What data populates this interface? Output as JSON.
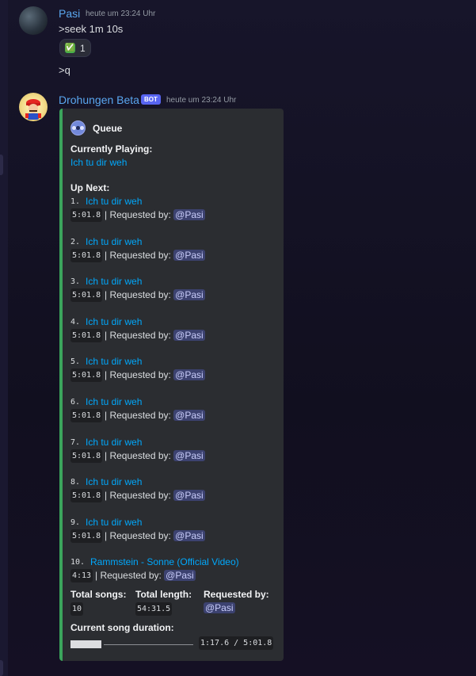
{
  "messages": [
    {
      "author": "Pasi",
      "timestamp": "heute um 23:24 Uhr",
      "lines": [
        ">seek 1m 10s",
        ">q"
      ],
      "reaction": {
        "emoji": "✅",
        "count": "1"
      }
    },
    {
      "author": "Drohungen Beta",
      "bot_tag": "BOT",
      "timestamp": "heute um 23:24 Uhr"
    }
  ],
  "embed": {
    "accent_color": "#3ba55c",
    "title": "Queue",
    "currently_playing_label": "Currently Playing:",
    "currently_playing": "Ich tu dir weh",
    "up_next_label": "Up Next:",
    "requested_by_text": "| Requested by:",
    "queue": [
      {
        "num": "1.",
        "title": "Ich tu dir weh",
        "duration": "5:01.8",
        "requester": "@Pasi"
      },
      {
        "num": "2.",
        "title": "Ich tu dir weh",
        "duration": "5:01.8",
        "requester": "@Pasi"
      },
      {
        "num": "3.",
        "title": "Ich tu dir weh",
        "duration": "5:01.8",
        "requester": "@Pasi"
      },
      {
        "num": "4.",
        "title": "Ich tu dir weh",
        "duration": "5:01.8",
        "requester": "@Pasi"
      },
      {
        "num": "5.",
        "title": "Ich tu dir weh",
        "duration": "5:01.8",
        "requester": "@Pasi"
      },
      {
        "num": "6.",
        "title": "Ich tu dir weh",
        "duration": "5:01.8",
        "requester": "@Pasi"
      },
      {
        "num": "7.",
        "title": "Ich tu dir weh",
        "duration": "5:01.8",
        "requester": "@Pasi"
      },
      {
        "num": "8.",
        "title": "Ich tu dir weh",
        "duration": "5:01.8",
        "requester": "@Pasi"
      },
      {
        "num": "9.",
        "title": "Ich tu dir weh",
        "duration": "5:01.8",
        "requester": "@Pasi"
      },
      {
        "num": "10.",
        "title": "Rammstein - Sonne (Official Video)",
        "duration": "4:13",
        "requester": "@Pasi"
      }
    ],
    "fields": [
      {
        "name": "Total songs:",
        "value": "10"
      },
      {
        "name": "Total length:",
        "value": "54:31.5"
      },
      {
        "name": "Requested by:",
        "value": "@Pasi"
      }
    ],
    "duration_label": "Current song duration:",
    "progress_text": "1:17.6 / 5:01.8",
    "progress_fraction": 0.257
  },
  "icons": [
    "check-mark-icon",
    "music-player-icon"
  ]
}
